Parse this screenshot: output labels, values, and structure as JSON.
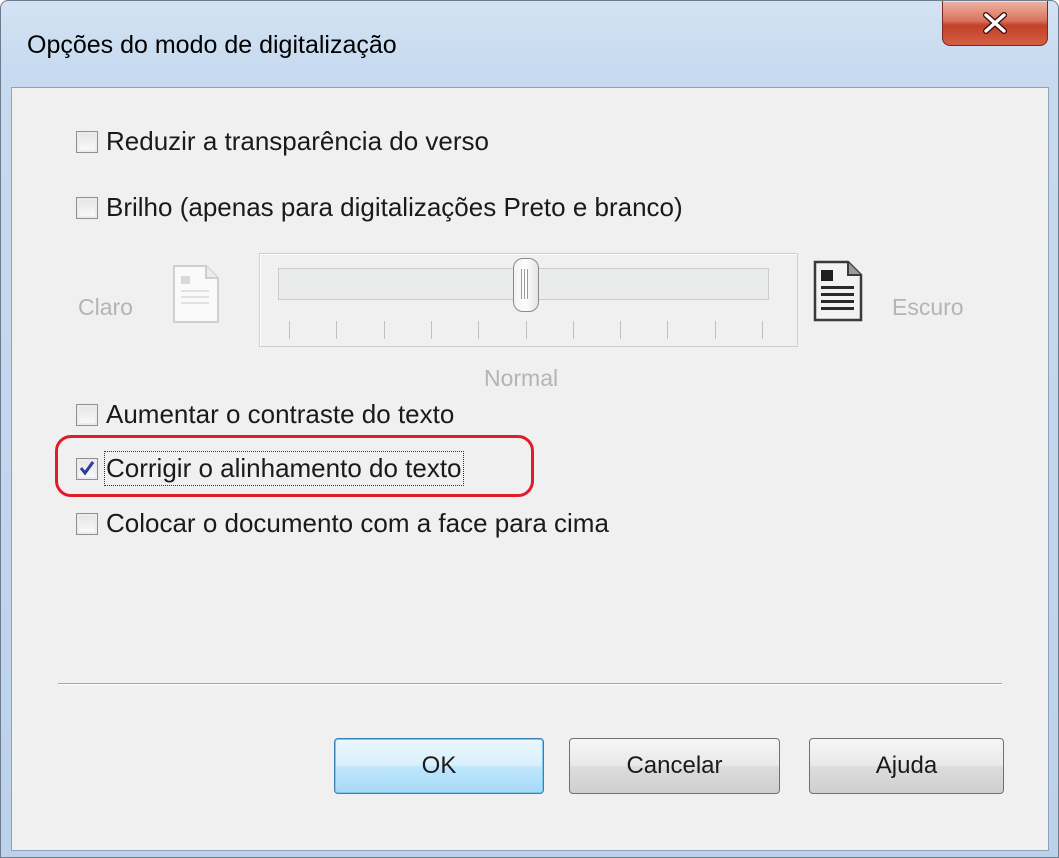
{
  "window": {
    "title": "Opções do modo de digitalização",
    "close_icon": "close-icon"
  },
  "options": {
    "reduce_bleed": {
      "label": "Reduzir a transparência do verso",
      "checked": false
    },
    "brightness": {
      "label": "Brilho (apenas para digitalizações Preto e branco)",
      "checked": false
    },
    "contrast": {
      "label": "Aumentar o contraste do texto",
      "checked": false
    },
    "alignment": {
      "label": "Corrigir o alinhamento do texto",
      "checked": true
    },
    "face_up": {
      "label": "Colocar o documento com a face para cima",
      "checked": false
    }
  },
  "brightness_slider": {
    "min_label": "Claro",
    "max_label": "Escuro",
    "center_label": "Normal",
    "level": 0.5,
    "tick_count": 11,
    "enabled": false,
    "min_icon": "light-document-icon",
    "max_icon": "dark-document-icon"
  },
  "buttons": {
    "ok": "OK",
    "cancel": "Cancelar",
    "help": "Ajuda"
  },
  "colors": {
    "highlight": "#e01c2b",
    "checkmark": "#2b3f9a",
    "disabled_text": "#b4b4b4"
  }
}
